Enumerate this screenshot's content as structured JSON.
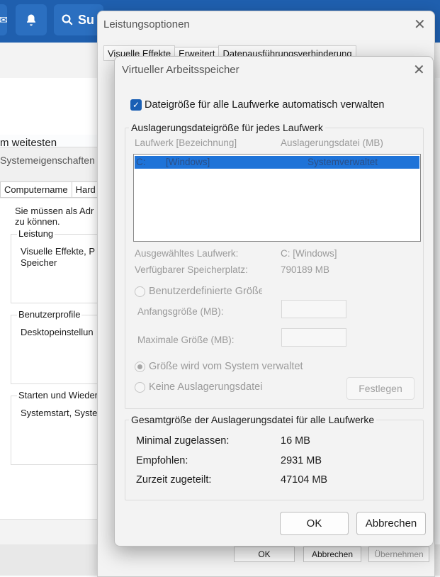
{
  "topbar": {
    "search_label": "Su"
  },
  "background": {
    "partial_heading": "m weitesten",
    "system_properties": {
      "title": "Systemeigenschaften",
      "tabs": [
        "Computername",
        "Hard"
      ],
      "admin_text_line1": "Sie müssen als Adr",
      "admin_text_line2": "zu können.",
      "performance": {
        "caption": "Leistung",
        "line1": "Visuelle Effekte, P",
        "line2": "Speicher"
      },
      "profiles": {
        "caption": "Benutzerprofile",
        "line1": "Desktopeinstellun"
      },
      "startup": {
        "caption": "Starten und Wieder",
        "line1": "Systemstart, Syste"
      }
    }
  },
  "perf_options": {
    "title": "Leistungsoptionen",
    "tabs": [
      {
        "label": "Visuelle Effekte",
        "active": false
      },
      {
        "label": "Erweitert",
        "active": true
      },
      {
        "label": "Datenausführungsverhinderung",
        "active": false
      }
    ],
    "ok": "OK",
    "cancel": "Abbrechen",
    "apply": "Übernehmen"
  },
  "virtual_memory": {
    "title": "Virtueller Arbeitsspeicher",
    "auto_manage_label": "Dateigröße für alle Laufwerke automatisch verwalten",
    "auto_manage_checked": true,
    "paging_group_caption": "Auslagerungsdateigröße für jedes Laufwerk",
    "col_drive": "Laufwerk [Bezeichnung]",
    "col_pagefile": "Auslagerungsdatei (MB)",
    "drives": [
      {
        "drive": "C:",
        "label": "[Windows]",
        "pagefile": "Systemverwaltet"
      }
    ],
    "selected_drive_label": "Ausgewähltes Laufwerk:",
    "selected_drive_value": "C:  [Windows]",
    "free_space_label": "Verfügbarer Speicherplatz:",
    "free_space_value": "790189 MB",
    "custom_size_label": "Benutzerdefinierte Größe",
    "initial_size_label": "Anfangsgröße (MB):",
    "initial_size_value": "",
    "max_size_label": "Maximale Größe (MB):",
    "max_size_value": "",
    "system_managed_label": "Größe wird vom System verwaltet",
    "no_pagefile_label": "Keine Auslagerungsdatei",
    "set_button": "Festlegen",
    "total_group_caption": "Gesamtgröße der Auslagerungsdatei für alle Laufwerke",
    "min_label": "Minimal zugelassen:",
    "min_value": "16 MB",
    "recommended_label": "Empfohlen:",
    "recommended_value": "2931 MB",
    "allocated_label": "Zurzeit zugeteilt:",
    "allocated_value": "47104 MB",
    "ok": "OK",
    "cancel": "Abbrechen"
  },
  "colors": {
    "accent": "#1e73d8",
    "checkbox": "#1a5fb4",
    "topbar": "#1f5fae"
  }
}
